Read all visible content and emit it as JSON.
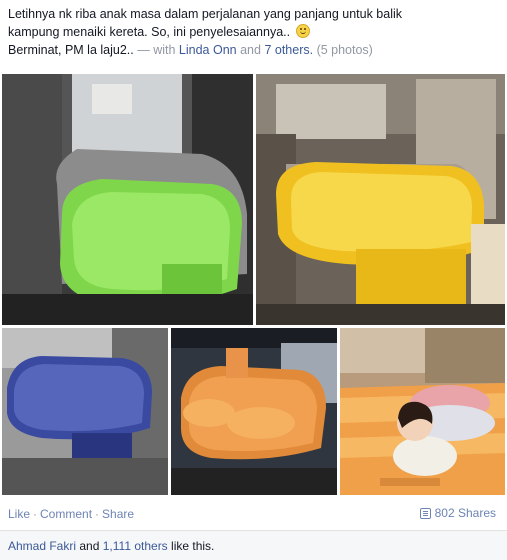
{
  "caption": {
    "line1": "Letihnya nk riba anak masa dalam perjalanan yang panjang untuk balik",
    "line2": "kampung menaiki kereta. So, ini penyelesaiannya..",
    "author_text": "Berminat, PM la laju2..",
    "with_prefix": "— with",
    "tagged_name": "Linda Onn",
    "and_text": "and",
    "others_link": "7 others.",
    "photo_count": "(5 photos)"
  },
  "photos": [
    {
      "name": "green car mattress"
    },
    {
      "name": "yellow car mattress"
    },
    {
      "name": "blue car mattress"
    },
    {
      "name": "orange car mattress with pillows"
    },
    {
      "name": "child sleeping on orange mattress"
    }
  ],
  "actions": {
    "like": "Like",
    "comment": "Comment",
    "share": "Share",
    "shares_count": "802 Shares"
  },
  "likes": {
    "name": "Ahmad Fakri",
    "and_text": "and",
    "others": "1,111 others",
    "suffix": "like this."
  },
  "colors": {
    "link": "#3b5998",
    "muted_link": "#6d84b4",
    "gray": "#9197a3"
  }
}
